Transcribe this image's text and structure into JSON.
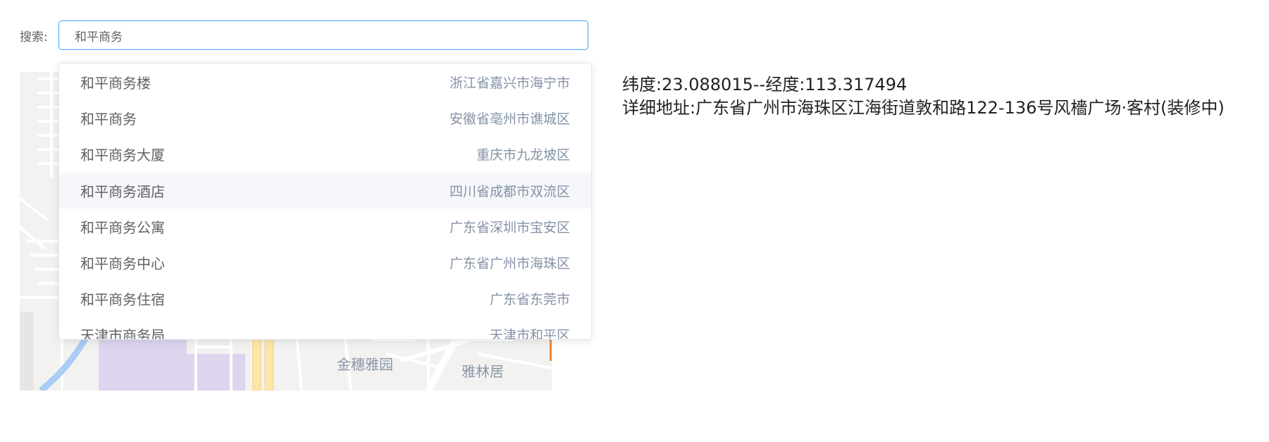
{
  "search": {
    "label": "搜索:",
    "value": "和平商务"
  },
  "suggestions": [
    {
      "name": "和平商务楼",
      "region": "浙江省嘉兴市海宁市"
    },
    {
      "name": "和平商务",
      "region": "安徽省亳州市谯城区"
    },
    {
      "name": "和平商务大厦",
      "region": "重庆市九龙坡区"
    },
    {
      "name": "和平商务酒店",
      "region": "四川省成都市双流区"
    },
    {
      "name": "和平商务公寓",
      "region": "广东省深圳市宝安区"
    },
    {
      "name": "和平商务中心",
      "region": "广东省广州市海珠区"
    },
    {
      "name": "和平商务住宿",
      "region": "广东省东莞市"
    },
    {
      "name": "天津市商务局",
      "region": "天津市和平区"
    }
  ],
  "map": {
    "labels": [
      "金穗雅园",
      "雅林居"
    ]
  },
  "info": {
    "coords": "纬度:23.088015--经度:113.317494",
    "address": "详细地址:广东省广州市海珠区江海街道敦和路122-136号风檣广场·客村(装修中)"
  },
  "colors": {
    "accent": "#409eff",
    "hover_bg": "#f5f7fa",
    "map_bg": "#f2f2f0",
    "park": "#ddd4ee",
    "river": "#a9cdf5",
    "major_road": "#fde6a8"
  }
}
